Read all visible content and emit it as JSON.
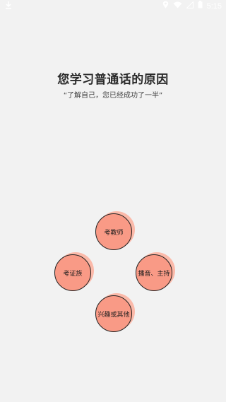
{
  "status_bar": {
    "time": "5:15",
    "icons": [
      "download-icon",
      "location-icon",
      "wifi-icon",
      "signal-icon",
      "battery-icon"
    ]
  },
  "page": {
    "title": "您学习普通话的原因",
    "subtitle": "“了解自己，您已经成功了一半”"
  },
  "options": [
    {
      "label": "考教师"
    },
    {
      "label": "考证族"
    },
    {
      "label": "播音、主持"
    },
    {
      "label": "兴趣或其他"
    }
  ],
  "colors": {
    "background": "#f2f2f2",
    "circle_fill": "#f99a86",
    "circle_shadow": "#fbb9a9",
    "circle_outline": "#222222"
  }
}
